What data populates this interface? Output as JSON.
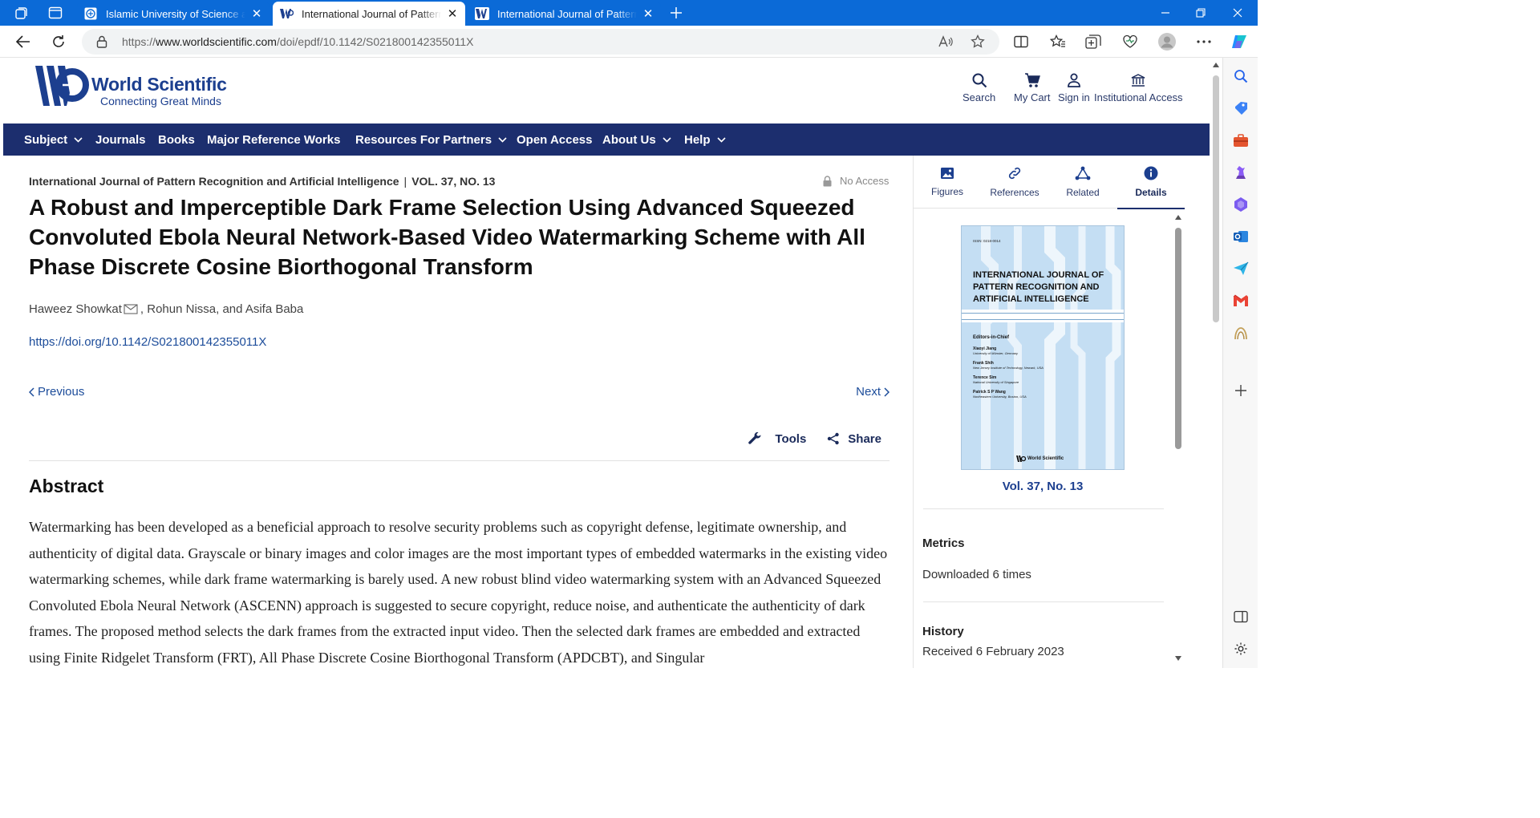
{
  "browser": {
    "tabs": [
      {
        "title": "Islamic University of Science and",
        "active": false
      },
      {
        "title": "International Journal of Pattern R",
        "active": true
      },
      {
        "title": "International Journal of Pattern R",
        "active": false
      }
    ],
    "url": {
      "scheme": "https://",
      "host": "www.worldscientific.com",
      "path": "/doi/epdf/10.1142/S021800142355011X"
    }
  },
  "site": {
    "brand_name": "World Scientific",
    "brand_tagline": "Connecting Great Minds",
    "header_actions": {
      "search": "Search",
      "cart": "My Cart",
      "signin": "Sign in",
      "institutional": "Institutional Access"
    },
    "nav": {
      "subject": "Subject",
      "journals": "Journals",
      "books": "Books",
      "major_reference": "Major Reference Works",
      "resources": "Resources For Partners",
      "open_access": "Open Access",
      "about": "About Us",
      "help": "Help"
    }
  },
  "article": {
    "journal": "International Journal of Pattern Recognition and Artificial Intelligence",
    "separator": "|",
    "volume": "VOL. 37, NO. 13",
    "access": "No Access",
    "title": "A Robust and Imperceptible Dark Frame Selection Using Advanced Squeezed Convoluted Ebola Neural Network-Based Video Watermarking Scheme with All Phase Discrete Cosine Biorthogonal Transform",
    "author1": "Haweez Showkat",
    "authors_rest": ", Rohun Nissa, and Asifa Baba",
    "doi": "https://doi.org/10.1142/S021800142355011X",
    "previous": "Previous",
    "next": "Next",
    "tools": "Tools",
    "share": "Share",
    "abstract_heading": "Abstract",
    "abstract": "Watermarking has been developed as a beneficial approach to resolve security problems such as copyright defense, legitimate ownership, and authenticity of digital data. Grayscale or binary images and color images are the most important types of embedded watermarks in the existing video watermarking schemes, while dark frame watermarking is barely used. A new robust blind video watermarking system with an Advanced Squeezed Convoluted Ebola Neural Network (ASCENN) approach is suggested to secure copyright, reduce noise, and authenticate the authenticity of dark frames. The proposed method selects the dark frames from the extracted input video. Then the selected dark frames are embedded and extracted using Finite Ridgelet Transform (FRT), All Phase Discrete Cosine Biorthogonal Transform (APDCBT), and Singular"
  },
  "panel": {
    "tabs": {
      "figures": "Figures",
      "references": "References",
      "related": "Related",
      "details": "Details"
    },
    "cover": {
      "issn": "ISSN: 0218-0014",
      "title": "INTERNATIONAL JOURNAL OF PATTERN RECOGNITION AND ARTIFICIAL INTELLIGENCE",
      "editors_heading": "Editors-in-Chief",
      "editors": [
        {
          "name": "Xiaoyi Jiang",
          "aff": "University of Münster, Germany"
        },
        {
          "name": "Frank Shih",
          "aff": "New Jersey Institute of Technology, Newark, USA"
        },
        {
          "name": "Terence Sim",
          "aff": "National University of Singapore"
        },
        {
          "name": "Patrick S P Wang",
          "aff": "Northeastern University, Boston, USA"
        }
      ],
      "publisher": "World Scientific"
    },
    "volume": "Vol. 37, No. 13",
    "metrics_heading": "Metrics",
    "metrics_value": "Downloaded 6 times",
    "history_heading": "History",
    "history_value": "Received 6 February 2023"
  }
}
